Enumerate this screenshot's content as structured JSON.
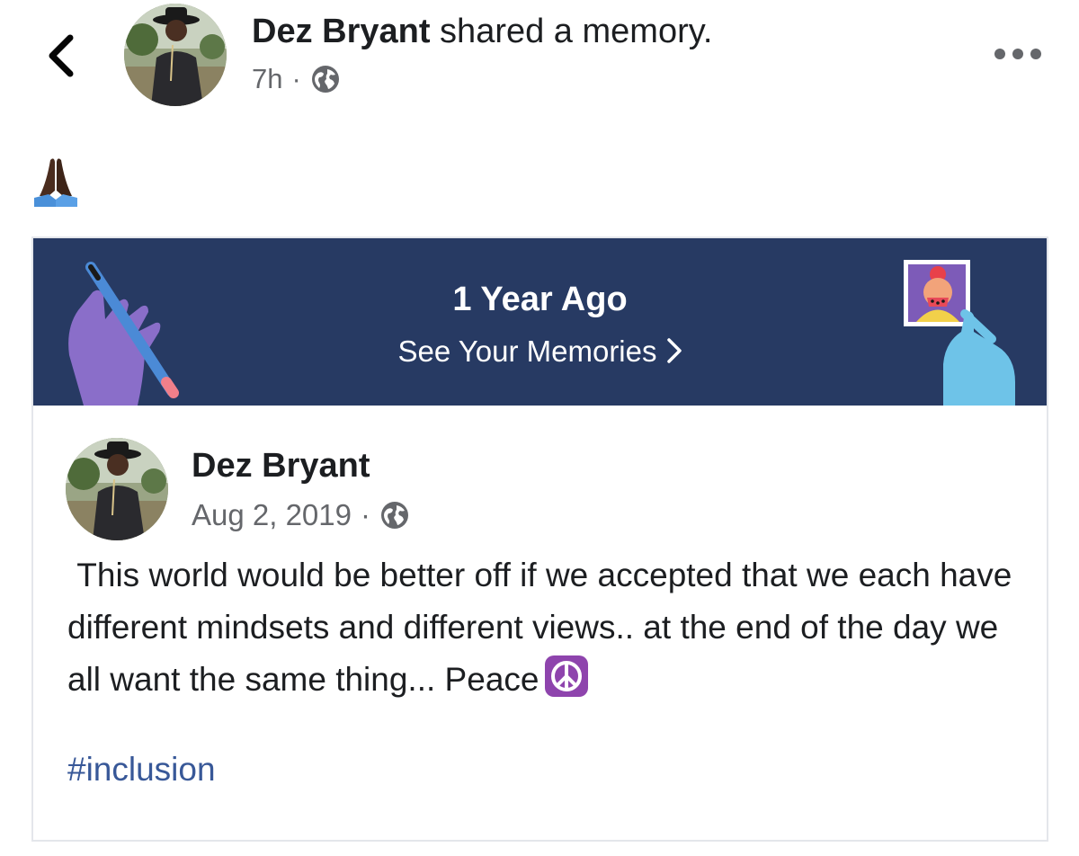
{
  "header": {
    "back_icon": "chevron-left-icon",
    "author_name": "Dez Bryant",
    "action_text": " shared a memory.",
    "time": "7h",
    "separator": "·",
    "privacy_icon": "globe-icon",
    "more_icon": "more-horizontal-icon"
  },
  "post": {
    "emoji": "🙏🏿",
    "emoji_icon": "folded-hands-emoji"
  },
  "memory": {
    "title": "1 Year Ago",
    "link_label": "See Your Memories",
    "link_icon": "chevron-right-icon",
    "banner_color": "#273a63",
    "original_post": {
      "author_name": "Dez Bryant",
      "date": "Aug 2, 2019",
      "separator": "·",
      "privacy_icon": "globe-icon",
      "text": " This world would be better off if we accepted that we each have different mindsets and different views.. at the end of the day we all want the same thing... Peace",
      "text_emoji_icon": "peace-symbol-emoji",
      "hashtag": "#inclusion"
    }
  },
  "colors": {
    "link_blue": "#385898",
    "secondary_text": "#65676b",
    "peace_purple": "#8e44ad"
  }
}
